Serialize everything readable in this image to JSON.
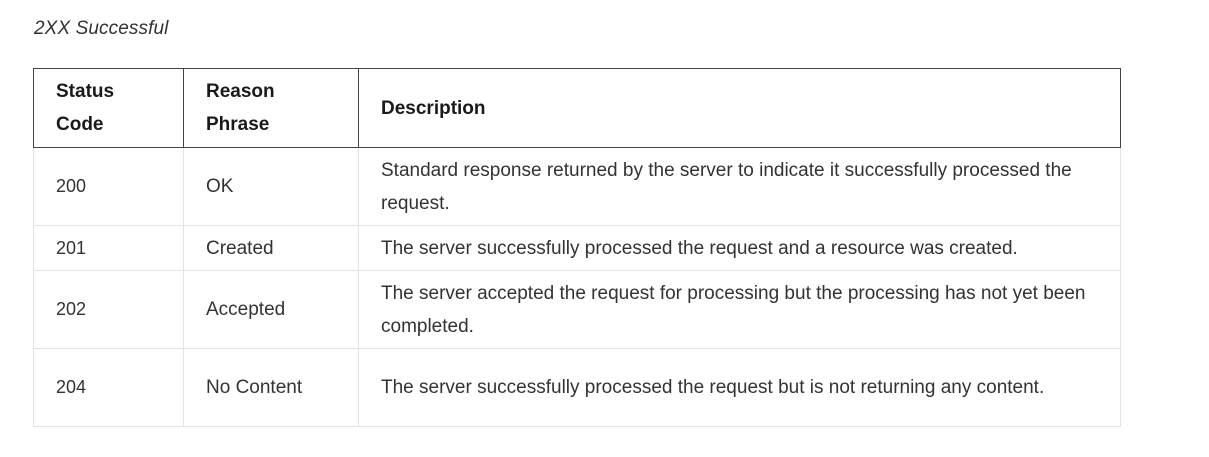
{
  "caption": "2XX Successful",
  "table": {
    "headers": {
      "status_code": "Status Code",
      "reason_phrase": "Reason Phrase",
      "description": "Description"
    },
    "rows": [
      {
        "code": "200",
        "phrase": "OK",
        "description": "Standard response returned by the server to indicate it successfully processed the request."
      },
      {
        "code": "201",
        "phrase": "Created",
        "description": "The server successfully processed the request and a resource was created."
      },
      {
        "code": "202",
        "phrase": "Accepted",
        "description": "The server accepted the request for processing but the processing has not yet been completed."
      },
      {
        "code": "204",
        "phrase": "No Content",
        "description": "The server successfully processed the request but is not returning any content."
      }
    ]
  }
}
